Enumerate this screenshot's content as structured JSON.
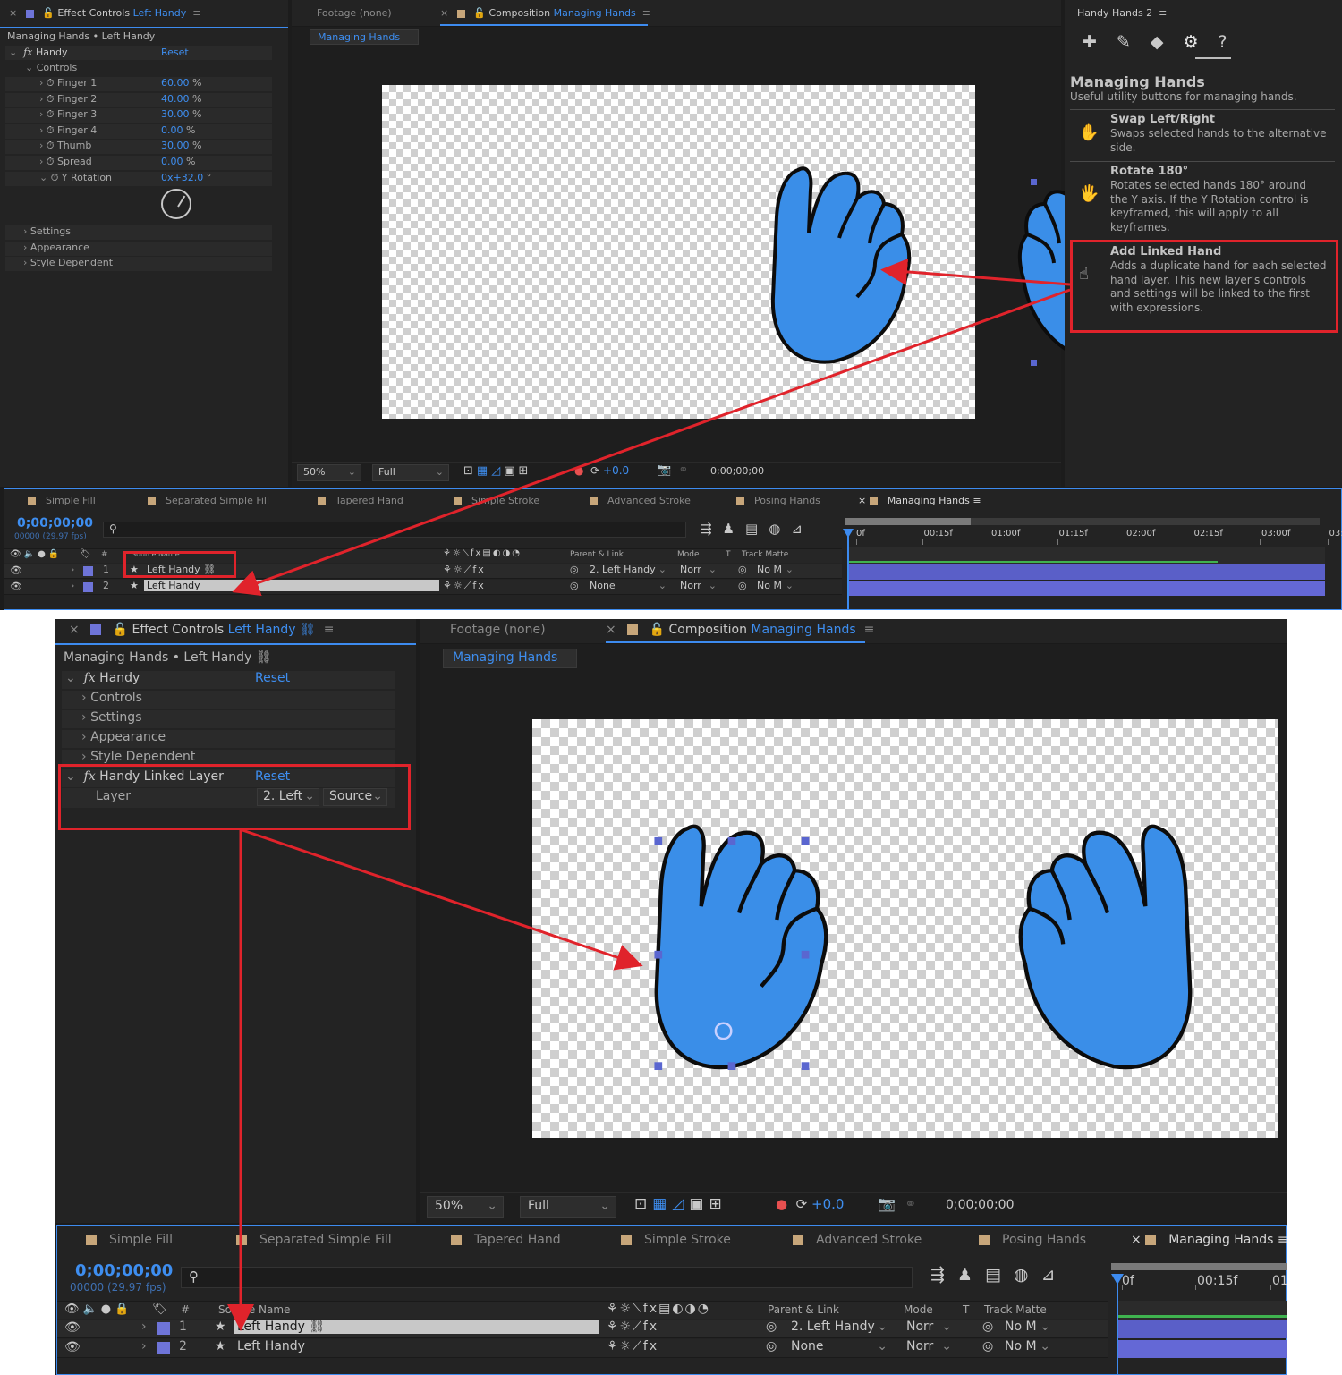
{
  "top": {
    "effect_tab": {
      "prefix": "Effect Controls",
      "layer": "Left Handy"
    },
    "footage_tab": "Footage  (none)",
    "comp_tab": {
      "prefix": "Composition",
      "name": "Managing Hands"
    },
    "comp_subtab": "Managing Hands",
    "handy_tab": "Handy Hands 2",
    "breadcrumb": "Managing Hands • Left Handy",
    "effect": {
      "name": "Handy",
      "reset": "Reset"
    },
    "controls_label": "Controls",
    "properties": [
      {
        "name": "Finger 1",
        "value": "60.00",
        "unit": "%"
      },
      {
        "name": "Finger 2",
        "value": "40.00",
        "unit": "%"
      },
      {
        "name": "Finger 3",
        "value": "30.00",
        "unit": "%"
      },
      {
        "name": "Finger 4",
        "value": "0.00",
        "unit": "%"
      },
      {
        "name": "Thumb",
        "value": "30.00",
        "unit": "%"
      },
      {
        "name": "Spread",
        "value": "0.00",
        "unit": "%"
      },
      {
        "name": "Y Rotation",
        "value": "0x+32.0",
        "unit": "°"
      }
    ],
    "groups": [
      "Settings",
      "Appearance",
      "Style Dependent"
    ],
    "viewer": {
      "zoom": "50%",
      "quality": "Full",
      "exposure": "+0.0",
      "timecode": "0;00;00;00"
    },
    "handy_panel": {
      "title": "Managing Hands",
      "subtitle": "Useful utility buttons for managing hands.",
      "items": [
        {
          "title": "Swap Left/Right",
          "lines": [
            "Swaps selected hands to the alternative",
            "side."
          ]
        },
        {
          "title": "Rotate 180°",
          "lines": [
            "Rotates selected hands 180° around",
            "the Y axis. If the Y Rotation control is",
            "keyframed, this will apply to all",
            "keyframes."
          ]
        },
        {
          "title": "Add Linked Hand",
          "lines": [
            "Adds a duplicate hand for each selected",
            "hand layer. This new layer's controls",
            "and settings will be linked to the first",
            "with expressions."
          ]
        }
      ]
    },
    "timeline_tabs": [
      "Simple Fill",
      "Separated Simple Fill",
      "Tapered Hand",
      "Simple Stroke",
      "Advanced Stroke",
      "Posing Hands",
      "Managing Hands"
    ],
    "timecode": "0;00;00;00",
    "fps": "00000 (29.97 fps)",
    "headers": {
      "hash": "#",
      "source": "Source Name",
      "parent": "Parent & Link",
      "mode": "Mode",
      "t": "T",
      "matte": "Track Matte"
    },
    "layers": [
      {
        "num": "1",
        "name": "Left Handy",
        "parent": "2. Left Handy",
        "mode": "Norr",
        "matte": "No M"
      },
      {
        "num": "2",
        "name": "Left Handy",
        "parent": "None",
        "mode": "Norr",
        "matte": "No M"
      }
    ],
    "ruler": [
      "0f",
      "00:15f",
      "01:00f",
      "01:15f",
      "02:00f",
      "02:15f",
      "03:00f",
      "03:1"
    ]
  },
  "bottom": {
    "effect_tab": {
      "prefix": "Effect Controls",
      "layer": "Left Handy"
    },
    "footage_tab": "Footage  (none)",
    "comp_tab": {
      "prefix": "Composition",
      "name": "Managing Hands"
    },
    "comp_subtab": "Managing Hands",
    "breadcrumb": "Managing Hands • Left Handy",
    "effect": {
      "name": "Handy",
      "reset": "Reset"
    },
    "groups": [
      "Controls",
      "Settings",
      "Appearance",
      "Style Dependent"
    ],
    "linked": {
      "name": "Handy Linked Layer",
      "reset": "Reset",
      "prop": "Layer",
      "layer_value": "2. Left",
      "source_value": "Source"
    },
    "viewer": {
      "zoom": "50%",
      "quality": "Full",
      "exposure": "+0.0",
      "timecode": "0;00;00;00"
    },
    "timeline_tabs": [
      "Simple Fill",
      "Separated Simple Fill",
      "Tapered Hand",
      "Simple Stroke",
      "Advanced Stroke",
      "Posing Hands",
      "Managing Hands"
    ],
    "timecode": "0;00;00;00",
    "fps": "00000 (29.97 fps)",
    "headers": {
      "hash": "#",
      "source": "Source Name",
      "parent": "Parent & Link",
      "mode": "Mode",
      "t": "T",
      "matte": "Track Matte"
    },
    "layers": [
      {
        "num": "1",
        "name": "Left Handy",
        "parent": "2. Left Handy",
        "mode": "Norr",
        "matte": "No M"
      },
      {
        "num": "2",
        "name": "Left Handy",
        "parent": "None",
        "mode": "Norr",
        "matte": "No M"
      }
    ],
    "ruler": [
      "0f",
      "00:15f",
      "01:"
    ]
  },
  "colors": {
    "accent": "#3e8ef0",
    "annotation": "#e0232b",
    "hand": "#3a8ee8",
    "label": "#6e74d8"
  }
}
